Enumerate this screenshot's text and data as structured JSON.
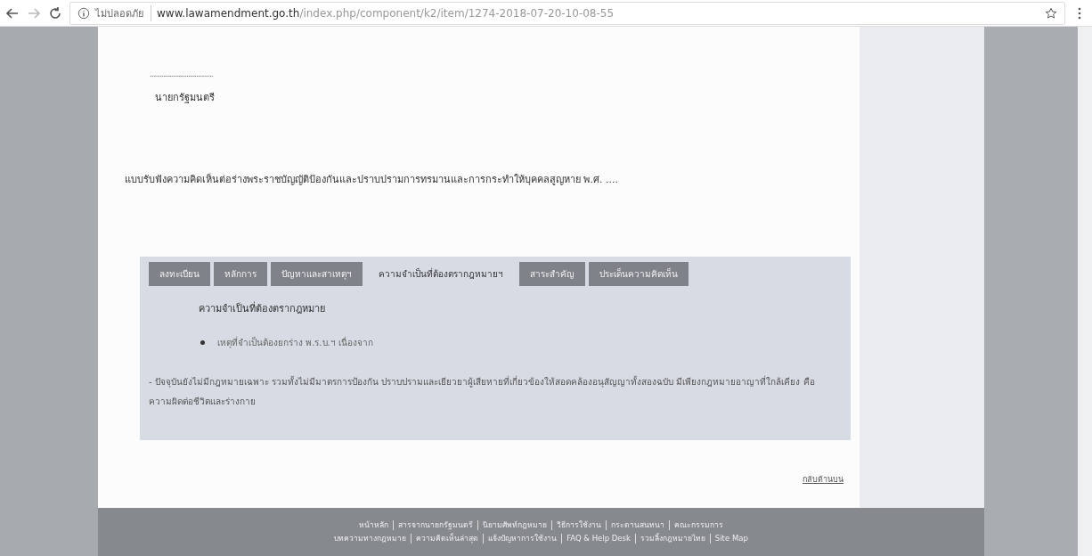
{
  "browser": {
    "security_label": "ไม่ปลอดภัย",
    "url_domain": "www.lawamendment.go.th",
    "url_path": "/index.php/component/k2/item/1274-2018-07-20-10-08-55"
  },
  "signature": {
    "dots": "......................................",
    "title": "นายกรัฐมนตรี"
  },
  "heading": "แบบรับฟังความคิดเห็นต่อร่างพระราชบัญญัติป้องกันและปราบปรามการทรมานและการกระทำให้บุคคลสูญหาย พ.ศ. ....",
  "tabs": [
    {
      "label": "ลงทะเบียน",
      "selected": false
    },
    {
      "label": "หลักการ",
      "selected": false
    },
    {
      "label": "ปัญหาและสาเหตุฯ",
      "selected": false
    },
    {
      "label": "ความจำเป็นที่ต้องตรากฎหมายฯ",
      "selected": true
    },
    {
      "label": "สาระสำคัญ",
      "selected": false
    },
    {
      "label": "ประเด็นความคิดเห็น",
      "selected": false
    }
  ],
  "panel": {
    "title": "ความจำเป็นที่ต้องตรากฎหมาย",
    "bullet": "เหตุที่จำเป็นต้องยกร่าง พ.ร.บ.ฯ เนื่องจาก",
    "paragraph": "- ปัจจุบันยังไม่มีกฎหมายเฉพาะ รวมทั้งไม่มีมาตรการป้องกัน ปราบปรามและเยียวยาผู้เสียหายที่เกี่ยวข้องให้สอดคล้องอนุสัญญาทั้งสองฉบับ มีเพียงกฎหมายอาญาที่ใกล้เคียง คือ ความผิดต่อชีวิตและร่างกาย"
  },
  "back_to_top": "กลับด้านบน",
  "footer": [
    [
      "หน้าหลัก",
      "สารจากนายกรัฐมนตรี",
      "นิยามศัพท์กฎหมาย",
      "วิธีการใช้งาน",
      "กระดานสนทนา",
      "คณะกรรมการ"
    ],
    [
      "บทความทางกฎหมาย",
      "ความคิดเห็นล่าสุด",
      "แจ้งปัญหาการใช้งาน",
      "FAQ & Help Desk",
      "รวมลิ้งกฎหมายไทย",
      "Site Map"
    ]
  ]
}
